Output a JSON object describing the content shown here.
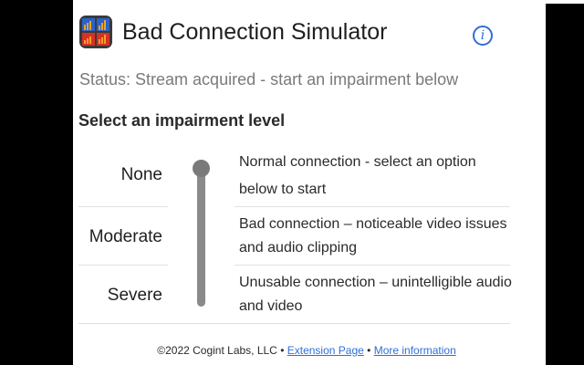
{
  "header": {
    "title": "Bad Connection Simulator",
    "logo_icon": "bar-chart-grid-icon",
    "info_icon": "info-icon",
    "info_symbol": "i"
  },
  "status": "Status: Stream acquired - start an impairment below",
  "section_title": "Select an impairment level",
  "levels": [
    {
      "label": "None",
      "description": "Normal connection - select an option below to start"
    },
    {
      "label": "Moderate",
      "description": "Bad connection – noticeable video issues and audio clipping"
    },
    {
      "label": "Severe",
      "description": "Unusable connection – unintelligible audio and video"
    }
  ],
  "slider": {
    "selected_level": "None"
  },
  "footer": {
    "copyright": "©2022 Cogint Labs, LLC",
    "separator": "•",
    "extension_page": "Extension Page",
    "more_info": "More information"
  },
  "colors": {
    "accent": "#2f6fd8",
    "slider": "#8a8a8a",
    "text": "#1f1f1f",
    "status": "#7a7a7a"
  }
}
